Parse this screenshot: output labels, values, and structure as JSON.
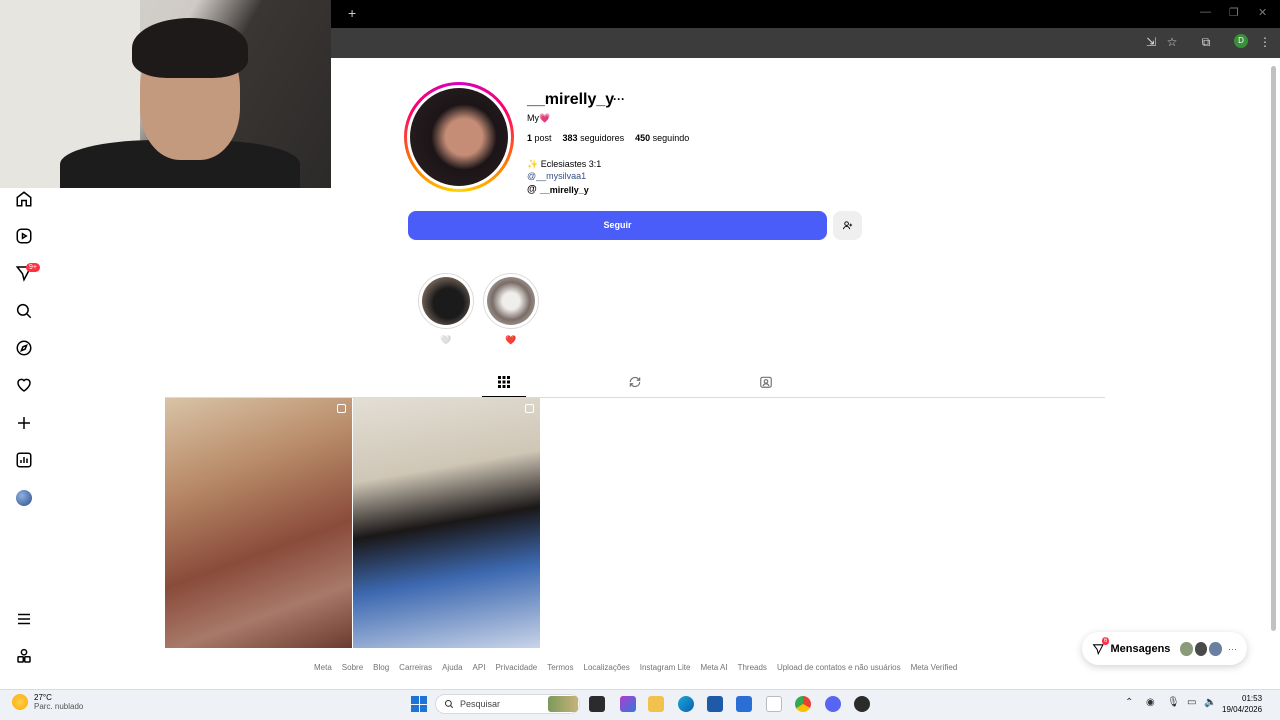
{
  "browser": {
    "new_tab_symbol": "+",
    "window_controls": [
      "—",
      "❐",
      "✕"
    ],
    "profile_initial": "D"
  },
  "nav": {
    "items": [
      "home",
      "reels",
      "messages",
      "search",
      "explore",
      "notifications",
      "create",
      "dashboard",
      "profile"
    ],
    "notification_badge": "9+"
  },
  "profile": {
    "username": "__mirelly_y",
    "more": "···",
    "bio_short": "My💗",
    "stats": {
      "posts_count": "1",
      "posts_label": "post",
      "followers_count": "383",
      "followers_label": "seguidores",
      "following_count": "450",
      "following_label": "seguindo"
    },
    "bio_line": "✨ Eclesiastes 3:1",
    "bio_link": "@__mysilvaa1",
    "threads_handle": "__mirelly_y",
    "follow_label": "Seguir"
  },
  "highlights": [
    {
      "label": "🤍"
    },
    {
      "label": "❤️"
    }
  ],
  "tabs": [
    "posts",
    "reposts",
    "tagged"
  ],
  "footer_links": [
    "Meta",
    "Sobre",
    "Blog",
    "Carreiras",
    "Ajuda",
    "API",
    "Privacidade",
    "Termos",
    "Localizações",
    "Instagram Lite",
    "Meta AI",
    "Threads",
    "Upload de contatos e não usuários",
    "Meta Verified"
  ],
  "messages": {
    "label": "Mensagens",
    "badge": "6",
    "more": "···"
  },
  "taskbar": {
    "weather_temp": "27°C",
    "weather_desc": "Parc. nublado",
    "search_placeholder": "Pesquisar",
    "time": "01:53",
    "date": "19/04/2026"
  },
  "colors": {
    "follow_button": "#4a5df9",
    "badge": "#ff3040",
    "link": "#385185"
  }
}
